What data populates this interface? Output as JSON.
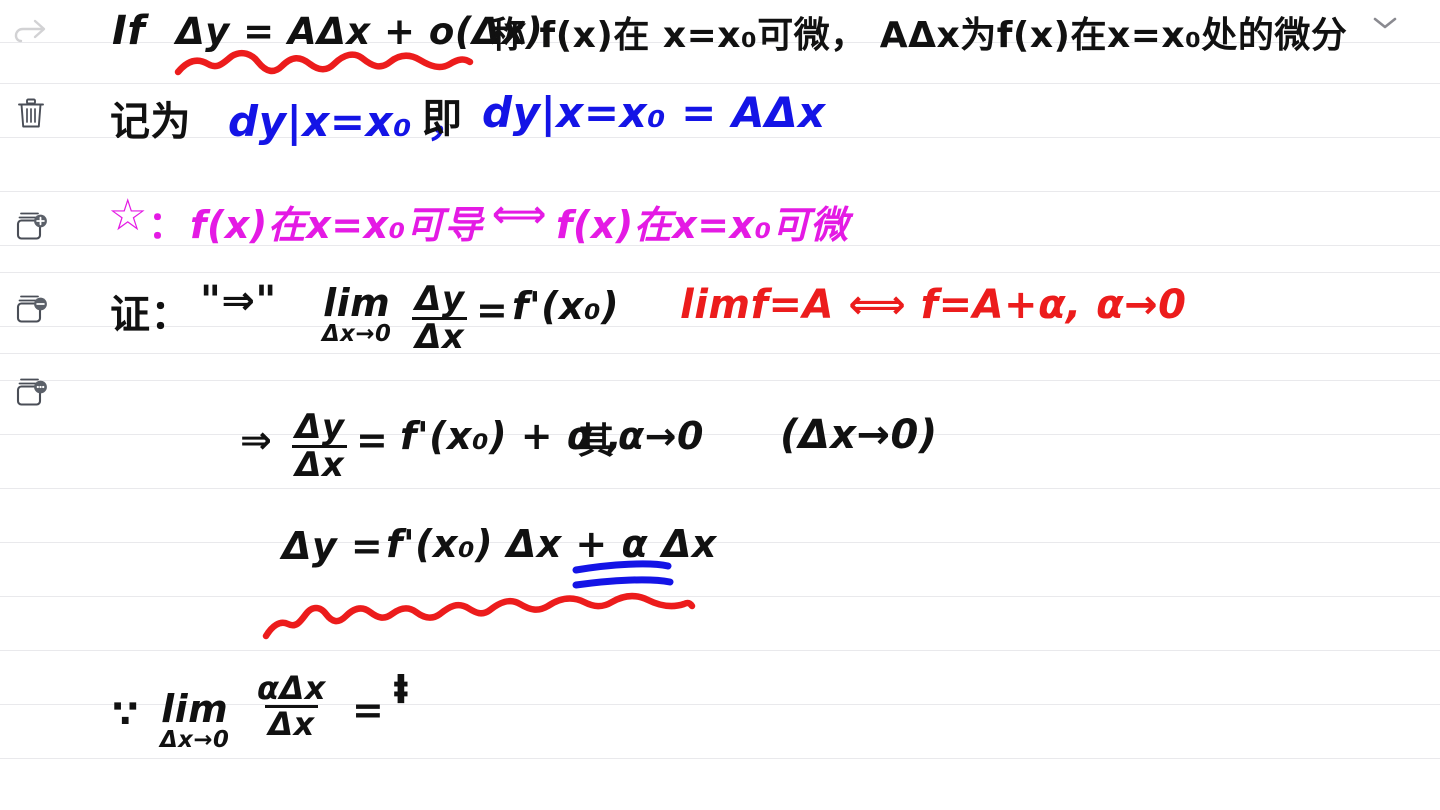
{
  "app": {
    "background_color": "#ffffff",
    "rule_color": "#e9e9ec",
    "ink_colors": {
      "black": "#111111",
      "blue": "#1414e6",
      "magenta": "#e41ae4",
      "red": "#ec1c1c"
    }
  },
  "toolbar": {
    "items": [
      {
        "name": "redo",
        "label": "Redo",
        "icon": "redo-arrow-icon",
        "state": "disabled"
      },
      {
        "name": "delete",
        "label": "Delete page",
        "icon": "trash-icon",
        "state": "enabled"
      },
      {
        "name": "add-page",
        "label": "Add page",
        "icon": "card-add-icon",
        "badge": "+"
      },
      {
        "name": "remove-page",
        "label": "Remove page",
        "icon": "card-remove-icon",
        "badge": "−"
      },
      {
        "name": "page-options",
        "label": "Page options",
        "icon": "card-more-icon",
        "badge": "•••"
      }
    ]
  },
  "header": {
    "collapse_icon": "chevron-down-icon"
  },
  "notes": {
    "line1": {
      "prefix": "If",
      "formula": "Δy = AΔx + o(Δx)",
      "chinese": "称 f(x)在 x=x₀可微， AΔx为f(x)在x=x₀处的微分",
      "underline": "red-wavy"
    },
    "line2": {
      "chinese_prefix": "记为",
      "blue_1": "dy|x=x₀ ，",
      "chinese_mid": "即",
      "blue_2": "dy|x=x₀ = AΔx"
    },
    "line3": {
      "star": "☆",
      "colon": "：",
      "left": "f(x)在x=x₀可导",
      "iff": "⟺",
      "right": "f(x)在x=x₀可微"
    },
    "line4": {
      "label": "证：",
      "quote": "\"⇒\"",
      "lim": "lim",
      "lim_sub": "Δx→0",
      "frac_num": "Δy",
      "frac_den": "Δx",
      "equals": "=",
      "rhs": "f'(x₀)"
    },
    "annotation_red": {
      "text": "limf=A  ⟺  f=A+α,  α→0"
    },
    "line5": {
      "implies": "⇒",
      "frac_num": "Δy",
      "frac_den": "Δx",
      "equals": "=",
      "rhs": "f'(x₀) + α ,",
      "chinese": "其",
      "tail": "α→0",
      "paren": "(Δx→0)"
    },
    "line6": {
      "lhs": "Δy =",
      "rhs": "f'(x₀) Δx + α Δx",
      "underline": "blue-double",
      "squiggle": "red-wavy"
    },
    "line7": {
      "because": "∵",
      "lim": "lim",
      "lim_sub": "Δx→0",
      "frac_num": "αΔx",
      "frac_den": "Δx",
      "equals": "=",
      "partial": "ⱡ"
    }
  }
}
